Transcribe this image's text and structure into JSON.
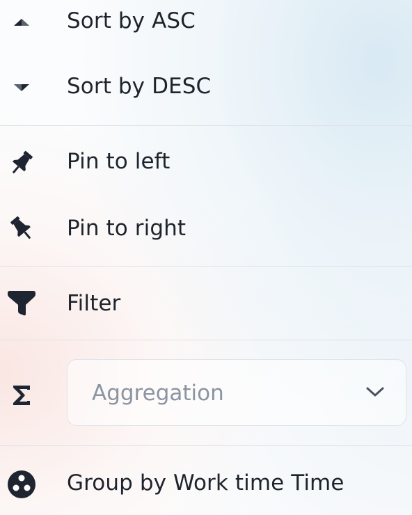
{
  "menu": {
    "sort_asc": {
      "label": "Sort by ASC",
      "icon": "sort-asc-icon"
    },
    "sort_desc": {
      "label": "Sort by DESC",
      "icon": "sort-desc-icon"
    },
    "pin_left": {
      "label": "Pin to left",
      "icon": "pin-left-icon"
    },
    "pin_right": {
      "label": "Pin to right",
      "icon": "pin-right-icon"
    },
    "filter": {
      "label": "Filter",
      "icon": "filter-icon"
    },
    "aggregation": {
      "icon": "sigma-icon",
      "placeholder": "Aggregation",
      "dropdown_icon": "chevron-down-icon"
    },
    "group_by": {
      "label": "Group by Work time Time",
      "icon": "group-icon"
    }
  },
  "colors": {
    "text": "#1e232c",
    "icon": "#1f2530",
    "placeholder": "#8a94a2",
    "divider": "#dfe2e6"
  }
}
